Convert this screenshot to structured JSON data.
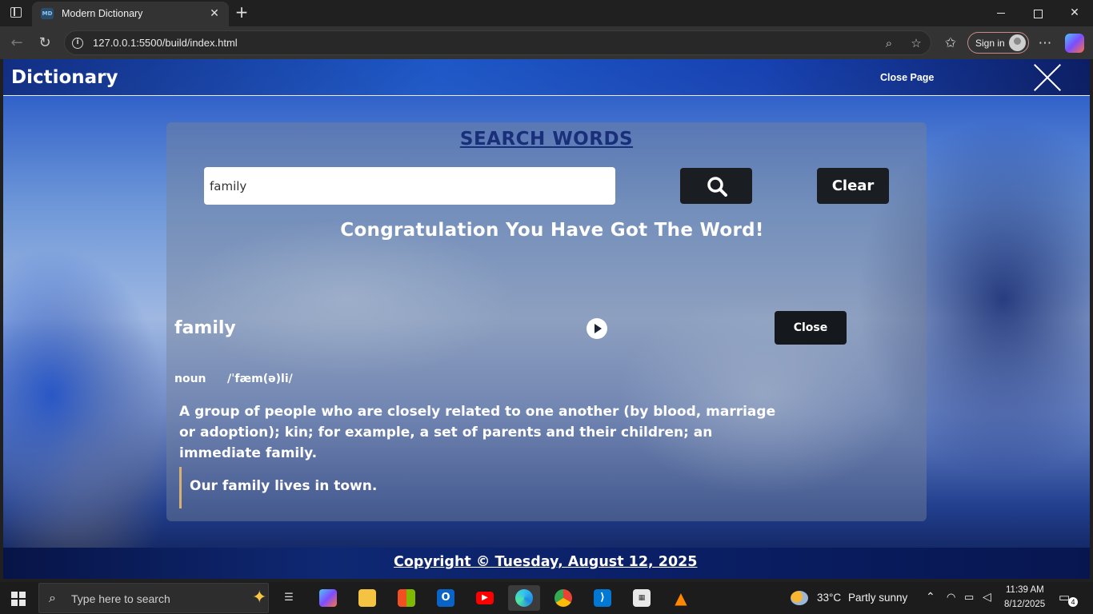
{
  "browser": {
    "tab_title": "Modern Dictionary",
    "tab_favicon_text": "MD",
    "url": "127.0.0.1:5500/build/index.html",
    "signin_label": "Sign in"
  },
  "app": {
    "brand": "Dictionary",
    "close_page_label": "Close Page",
    "panel_title": "SEARCH WORDS",
    "search_value": "family",
    "clear_label": "Clear",
    "result_message": "Congratulation You Have Got The Word!",
    "entry": {
      "word": "family",
      "part_of_speech": "noun",
      "phonetic": "/ˈfæm(ə)li/",
      "definition": "A group of people who are closely related to one another (by blood, marriage or adoption); kin; for example, a set of parents and their children; an immediate family.",
      "example": "Our family lives in town."
    },
    "close_label": "Close",
    "copyright": "Copyright © Tuesday, August 12, 2025"
  },
  "taskbar": {
    "search_placeholder": "Type here to search",
    "weather_temp": "33°C",
    "weather_desc": "Partly sunny",
    "time": "11:39 AM",
    "date": "8/12/2025",
    "notification_count": "4"
  },
  "colors": {
    "title_blue": "#1a2f7a",
    "button_dark": "#1a1d22",
    "example_border": "#d7b16f",
    "footer_navy": "#0f2873"
  }
}
